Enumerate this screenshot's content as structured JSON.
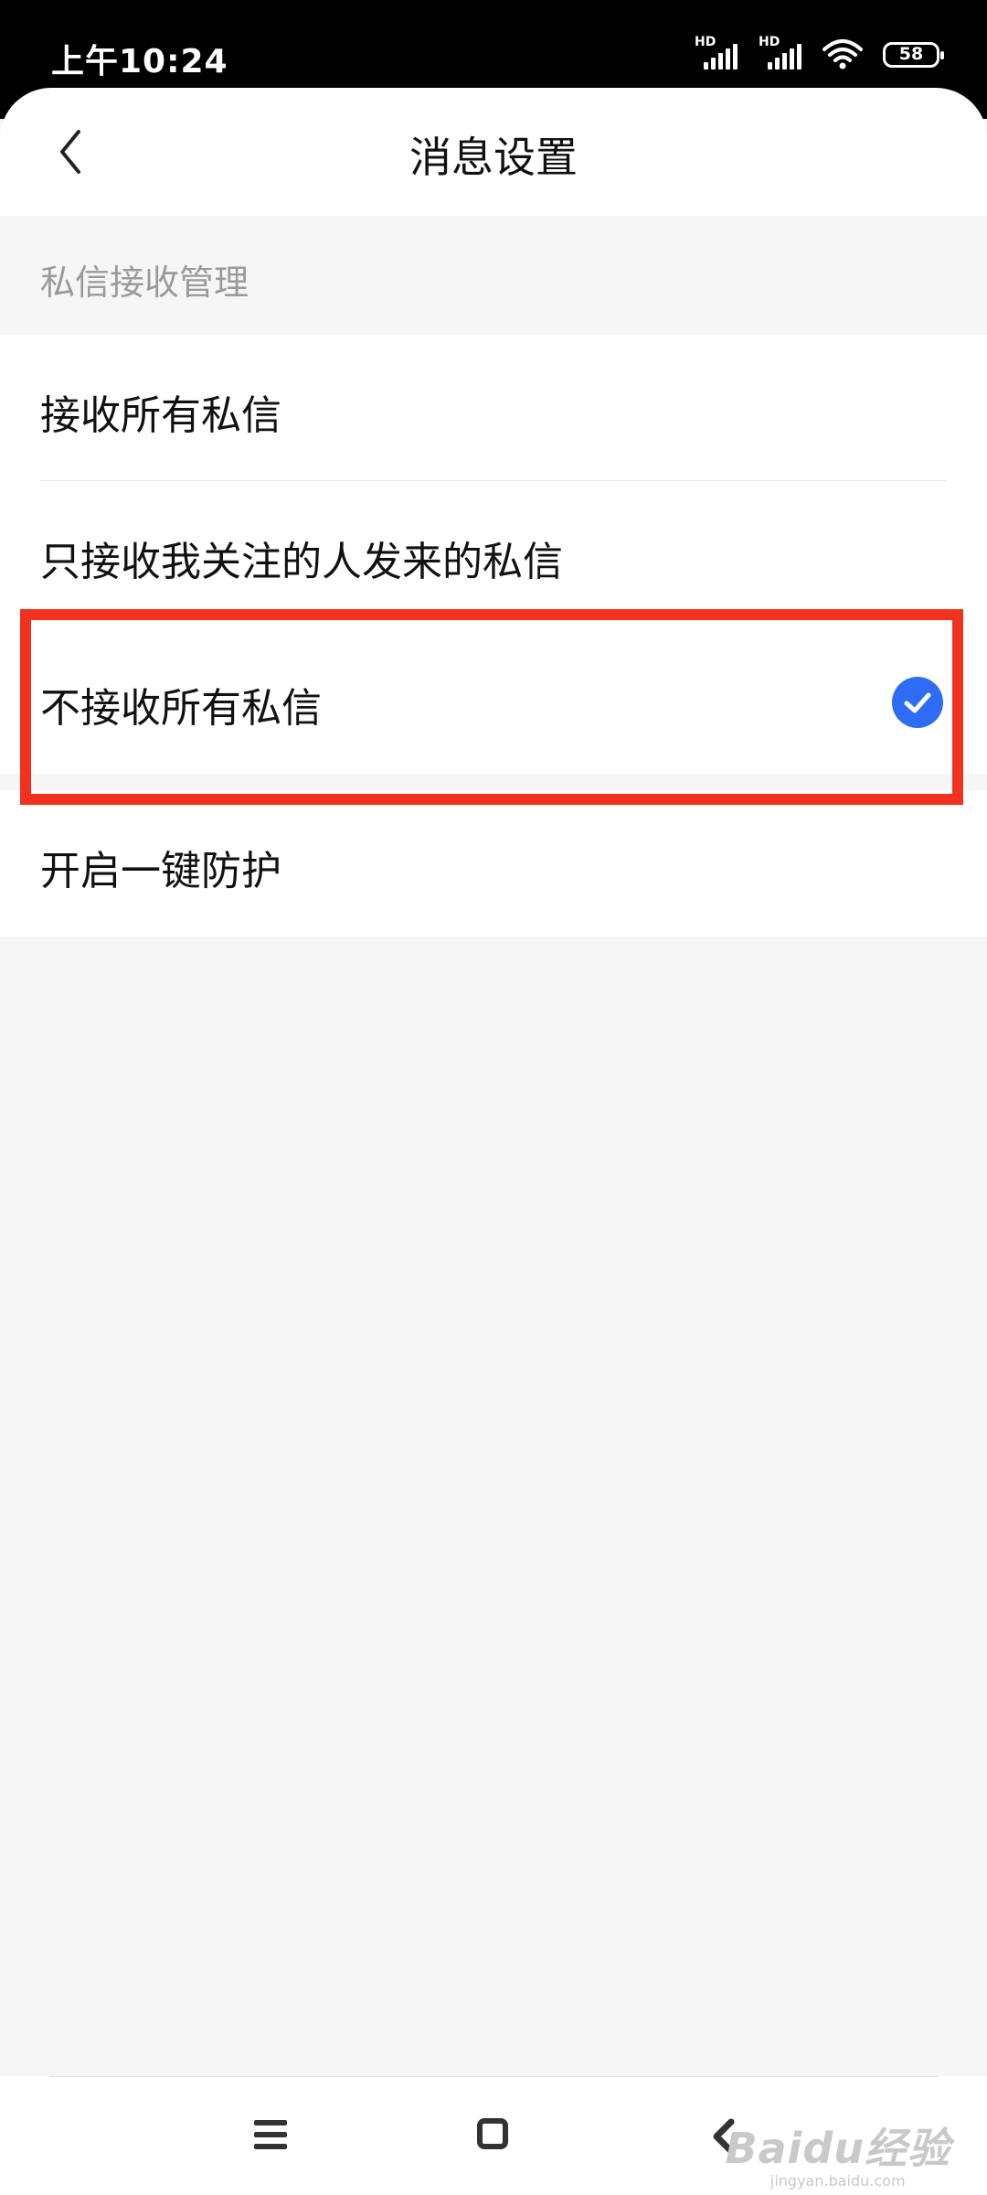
{
  "status_bar": {
    "time": "上午10:24",
    "signal_labels": [
      "HD",
      "HD"
    ],
    "battery_level": "58",
    "icons": [
      "signal-icon",
      "signal-icon",
      "wifi-icon",
      "battery-icon"
    ]
  },
  "header": {
    "title": "消息设置",
    "back_icon": "chevron-left-icon"
  },
  "section": {
    "title": "私信接收管理"
  },
  "options": [
    {
      "label": "接收所有私信",
      "selected": false
    },
    {
      "label": "只接收我关注的人发来的私信",
      "selected": false
    },
    {
      "label": "不接收所有私信",
      "selected": true
    }
  ],
  "protection": {
    "label": "开启一键防护"
  },
  "highlight_color": "#f2321e",
  "check_color": "#2f6cf6",
  "nav_bar": {
    "icons": [
      "menu-icon",
      "home-icon",
      "back-icon"
    ]
  },
  "watermark": {
    "main": "Baidu经验",
    "sub": "jingyan.baidu.com"
  }
}
